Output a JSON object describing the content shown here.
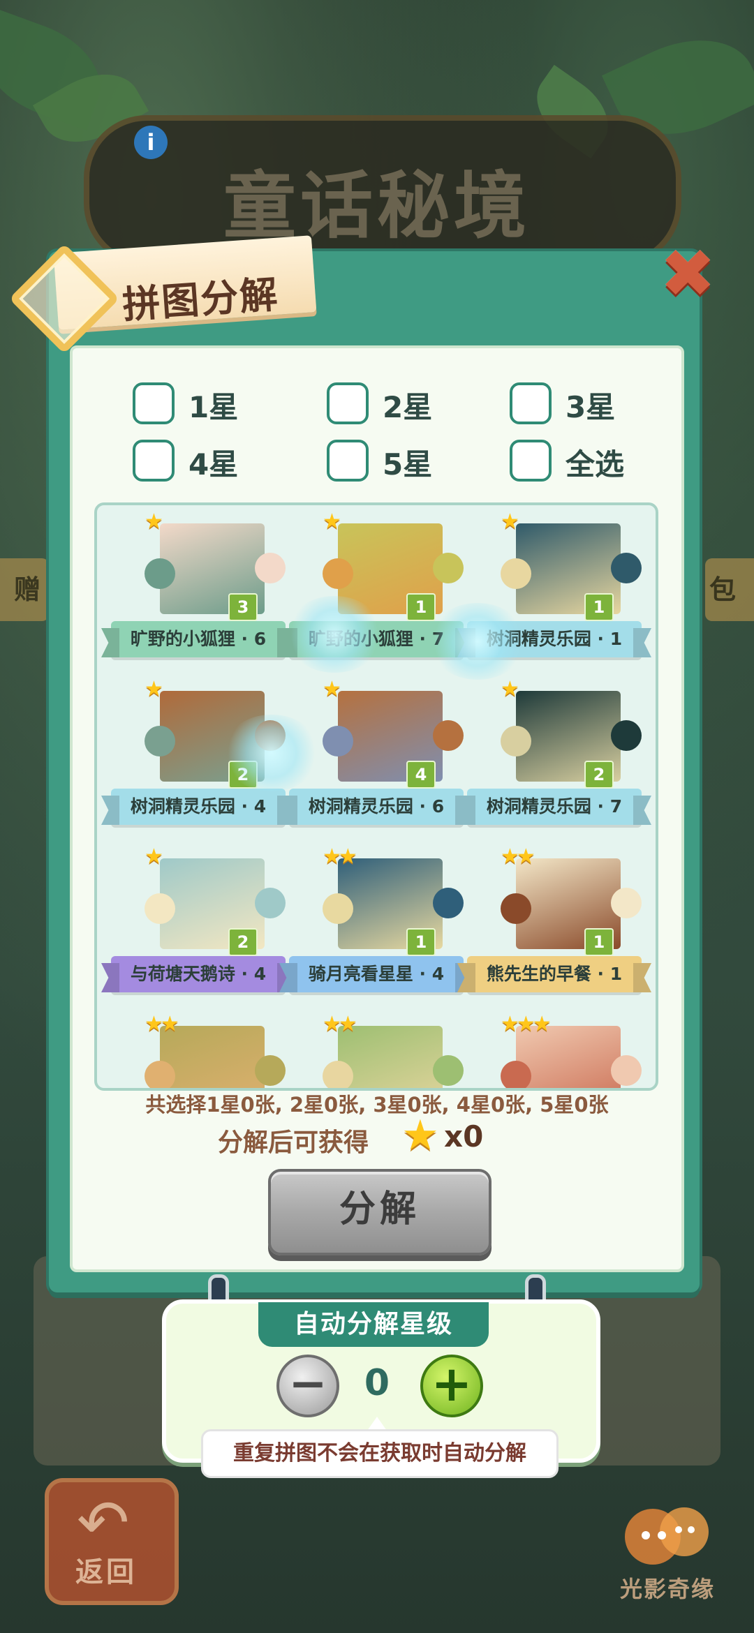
{
  "background": {
    "game_title": "童话秘境",
    "side_left_text": "赠",
    "side_right_text": "包",
    "return_label": "返回",
    "logo_text": "光影奇缘"
  },
  "modal": {
    "title": "拼图分解",
    "close_icon": "close-icon"
  },
  "filters": [
    {
      "label": "1星",
      "checked": false
    },
    {
      "label": "2星",
      "checked": false
    },
    {
      "label": "3星",
      "checked": false
    },
    {
      "label": "4星",
      "checked": false
    },
    {
      "label": "5星",
      "checked": false
    },
    {
      "label": "全选",
      "checked": false
    }
  ],
  "pieces": [
    {
      "name": "旷野的小狐狸 · 6",
      "stars": "★",
      "count": "3",
      "banner_color": "#8fd3b4",
      "art": [
        "#f3d9c9",
        "#6c9c8a"
      ]
    },
    {
      "name": "旷野的小狐狸 · 7",
      "stars": "★",
      "count": "1",
      "banner_color": "#8fd3b4",
      "art": [
        "#c8c45a",
        "#e0a04a"
      ]
    },
    {
      "name": "树洞精灵乐园 · 1",
      "stars": "★",
      "count": "1",
      "banner_color": "#a3dde9",
      "art": [
        "#2f5a6a",
        "#e8d7a0"
      ]
    },
    {
      "name": "树洞精灵乐园 · 4",
      "stars": "★",
      "count": "2",
      "banner_color": "#a3dde9",
      "art": [
        "#b06a3a",
        "#7aa090"
      ]
    },
    {
      "name": "树洞精灵乐园 · 6",
      "stars": "★",
      "count": "4",
      "banner_color": "#a3dde9",
      "art": [
        "#b5713f",
        "#7f8fb0"
      ]
    },
    {
      "name": "树洞精灵乐园 · 7",
      "stars": "★",
      "count": "2",
      "banner_color": "#a3dde9",
      "art": [
        "#1e3a3a",
        "#d8cfa0"
      ]
    },
    {
      "name": "与荷塘天鹅诗 · 4",
      "stars": "★",
      "count": "2",
      "banner_color": "#a48be0",
      "art": [
        "#9fc9c8",
        "#f3e7c2"
      ]
    },
    {
      "name": "骑月亮看星星 · 4",
      "stars": "★★",
      "count": "1",
      "banner_color": "#8fc3ee",
      "art": [
        "#2f5f7a",
        "#e8d9a0"
      ]
    },
    {
      "name": "熊先生的早餐 · 1",
      "stars": "★★",
      "count": "1",
      "banner_color": "#efcf82",
      "art": [
        "#f3e7c8",
        "#8a4a2a"
      ]
    },
    {
      "name": "",
      "stars": "★★",
      "count": "",
      "banner_color": "",
      "art": [
        "#b6a95a",
        "#e0b070"
      ]
    },
    {
      "name": "",
      "stars": "★★",
      "count": "",
      "banner_color": "",
      "art": [
        "#9dbf72",
        "#e8d6a0"
      ]
    },
    {
      "name": "",
      "stars": "★★★",
      "count": "",
      "banner_color": "",
      "art": [
        "#f0c9b0",
        "#c96a50"
      ]
    }
  ],
  "summary": "共选择1星0张, 2星0张, 3星0张, 4星0张, 5星0张",
  "gain": {
    "label": "分解后可获得",
    "star_icon": "star-icon",
    "amount": "x0"
  },
  "decompose_button": "分解",
  "auto": {
    "title": "自动分解星级",
    "value": "0",
    "minus": "−",
    "plus": "+",
    "hint": "重复拼图不会在获取时自动分解"
  }
}
